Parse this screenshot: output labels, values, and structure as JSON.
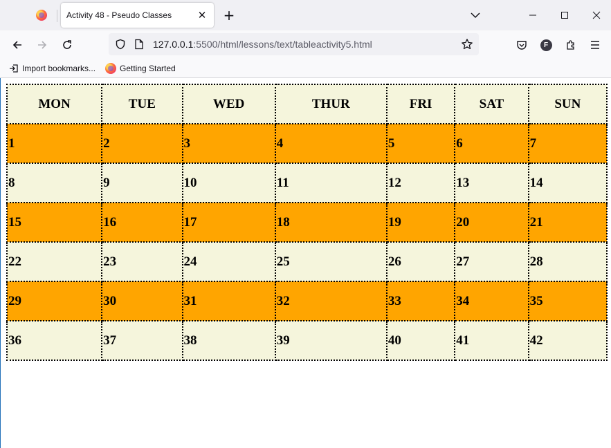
{
  "browser": {
    "tab_title": "Activity 48 - Pseudo Classes",
    "url_host": "127.0.0.1",
    "url_path": ":5500/html/lessons/text/tableactivity5.html",
    "bookmarks": [
      {
        "label": "Import bookmarks..."
      },
      {
        "label": "Getting Started"
      }
    ],
    "account_initial": "F"
  },
  "calendar": {
    "headers": [
      "MON",
      "TUE",
      "WED",
      "THUR",
      "FRI",
      "SAT",
      "SUN"
    ],
    "rows": [
      [
        "1",
        "2",
        "3",
        "4",
        "5",
        "6",
        "7"
      ],
      [
        "8",
        "9",
        "10",
        "11",
        "12",
        "13",
        "14"
      ],
      [
        "15",
        "16",
        "17",
        "18",
        "19",
        "20",
        "21"
      ],
      [
        "22",
        "23",
        "24",
        "25",
        "26",
        "27",
        "28"
      ],
      [
        "29",
        "30",
        "31",
        "32",
        "33",
        "34",
        "35"
      ],
      [
        "36",
        "37",
        "38",
        "39",
        "40",
        "41",
        "42"
      ]
    ],
    "colors": {
      "header_bg": "#f5f5dc",
      "odd_row_bg": "#ffa500",
      "even_row_bg": "#f5f5dc"
    }
  }
}
